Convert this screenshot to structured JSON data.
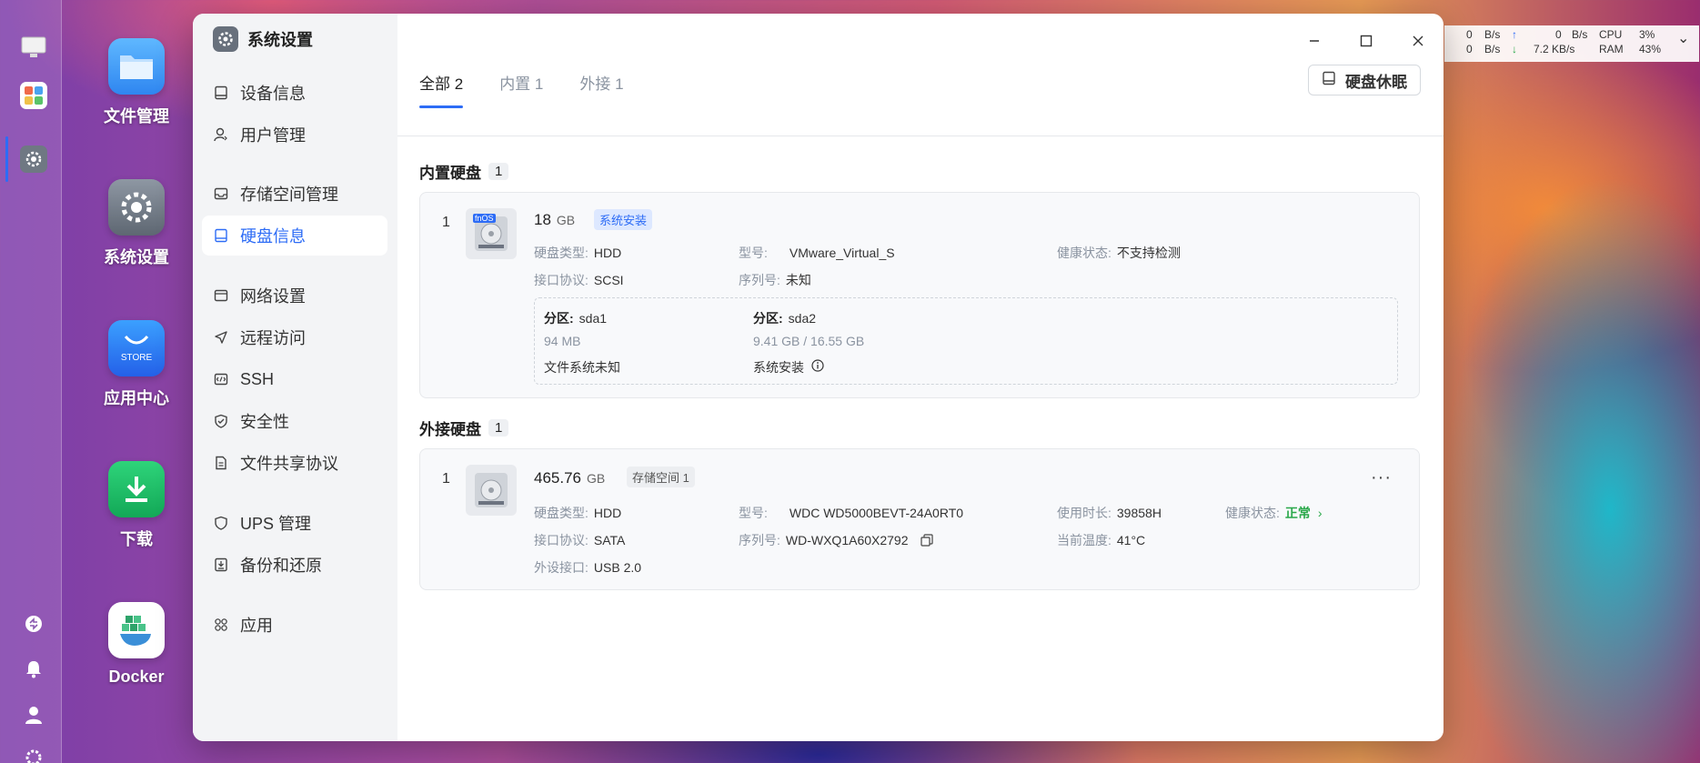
{
  "desktop": {
    "apps": [
      {
        "name": "文件管理"
      },
      {
        "name": "系统设置"
      },
      {
        "name": "应用中心",
        "tile_text": "STORE"
      },
      {
        "name": "下载"
      },
      {
        "name": "Docker"
      }
    ]
  },
  "statusbar": {
    "up_speed": "0",
    "up_unit": "B/s",
    "down_speed": "0",
    "down_unit": "B/s",
    "up_speed_2": "0",
    "up_unit_2": "B/s",
    "down_speed_2": "7.2",
    "down_unit_2": "KB/s",
    "cpu_label": "CPU",
    "cpu_value": "3%",
    "ram_label": "RAM",
    "ram_value": "43%"
  },
  "window": {
    "title": "系统设置",
    "nav": [
      {
        "label": "设备信息",
        "icon": "device-icon"
      },
      {
        "label": "用户管理",
        "icon": "user-icon"
      },
      {
        "label": "存储空间管理",
        "icon": "storage-icon"
      },
      {
        "label": "硬盘信息",
        "icon": "disk-icon",
        "active": true
      },
      {
        "label": "网络设置",
        "icon": "network-icon"
      },
      {
        "label": "远程访问",
        "icon": "remote-icon"
      },
      {
        "label": "SSH",
        "icon": "ssh-icon"
      },
      {
        "label": "安全性",
        "icon": "shield-icon"
      },
      {
        "label": "文件共享协议",
        "icon": "file-share-icon"
      },
      {
        "label": "UPS 管理",
        "icon": "ups-icon"
      },
      {
        "label": "备份和还原",
        "icon": "backup-icon"
      },
      {
        "label": "应用",
        "icon": "apps-icon"
      }
    ],
    "tabs": [
      {
        "label": "全部 2",
        "active": true
      },
      {
        "label": "内置 1"
      },
      {
        "label": "外接 1"
      }
    ],
    "sleep_button": "硬盘休眠"
  },
  "internal": {
    "title": "内置硬盘",
    "count": "1",
    "disk": {
      "index": "1",
      "badge": "fnOS",
      "size": "18",
      "unit": "GB",
      "tag": "系统安装",
      "type_label": "硬盘类型:",
      "type": "HDD",
      "model_label": "型号:",
      "model": "VMware_Virtual_S",
      "health_label": "健康状态:",
      "health": "不支持检测",
      "iface_label": "接口协议:",
      "iface": "SCSI",
      "serial_label": "序列号:",
      "serial": "未知",
      "partitions": [
        {
          "label": "分区:",
          "name": "sda1",
          "size": "94 MB",
          "fs": "文件系统未知"
        },
        {
          "label": "分区:",
          "name": "sda2",
          "size": "9.41 GB / 16.55 GB",
          "fs": "系统安装"
        }
      ]
    }
  },
  "external": {
    "title": "外接硬盘",
    "count": "1",
    "disk": {
      "index": "1",
      "size": "465.76",
      "unit": "GB",
      "tag": "存储空间 1",
      "type_label": "硬盘类型:",
      "type": "HDD",
      "model_label": "型号:",
      "model": "WDC WD5000BEVT-24A0RT0",
      "hours_label": "使用时长:",
      "hours": "39858H",
      "health_label": "健康状态:",
      "health": "正常",
      "iface_label": "接口协议:",
      "iface": "SATA",
      "serial_label": "序列号:",
      "serial": "WD-WXQ1A60X2792",
      "temp_label": "当前温度:",
      "temp": "41°C",
      "port_label": "外设接口:",
      "port": "USB 2.0"
    }
  }
}
